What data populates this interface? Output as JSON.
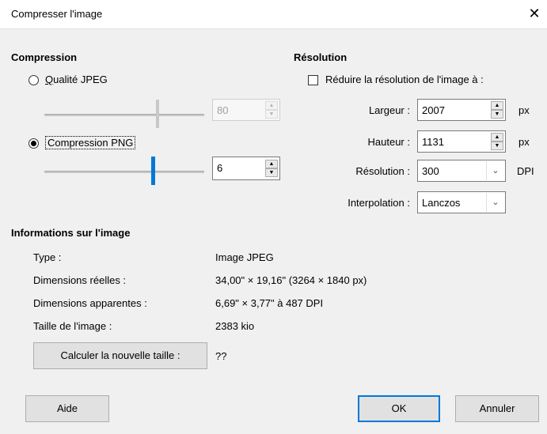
{
  "window": {
    "title": "Compresser l'image",
    "close_glyph": "✕"
  },
  "compression": {
    "heading": "Compression",
    "jpeg_label": "Qualité JPEG",
    "jpeg_selected": false,
    "jpeg_value": "80",
    "jpeg_slider_level": 0.7,
    "png_label": "Compression PNG",
    "png_selected": true,
    "png_value": "6",
    "png_slider_level": 0.67
  },
  "resolution": {
    "heading": "Résolution",
    "reduce_label": "Réduire la résolution de l'image à :",
    "reduce_checked": false,
    "width_label": "Largeur :",
    "width_value": "2007",
    "width_unit": "px",
    "height_label": "Hauteur :",
    "height_value": "1131",
    "height_unit": "px",
    "res_label": "Résolution :",
    "res_value": "300",
    "res_unit": "DPI",
    "interp_label": "Interpolation :",
    "interp_value": "Lanczos"
  },
  "info": {
    "heading": "Informations sur l'image",
    "rows": [
      {
        "label": "Type :",
        "value": "Image JPEG"
      },
      {
        "label": "Dimensions réelles :",
        "value": "34,00\" × 19,16\" (3264 × 1840 px)"
      },
      {
        "label": "Dimensions apparentes :",
        "value": "6,69\" × 3,77\" à 487 DPI"
      },
      {
        "label": "Taille de l'image :",
        "value": "2383 kio"
      }
    ],
    "calc_button": "Calculer la nouvelle taille :",
    "calc_result": "??"
  },
  "buttons": {
    "help": "Aide",
    "ok": "OK",
    "cancel": "Annuler"
  },
  "colors": {
    "accent": "#0078d7"
  }
}
